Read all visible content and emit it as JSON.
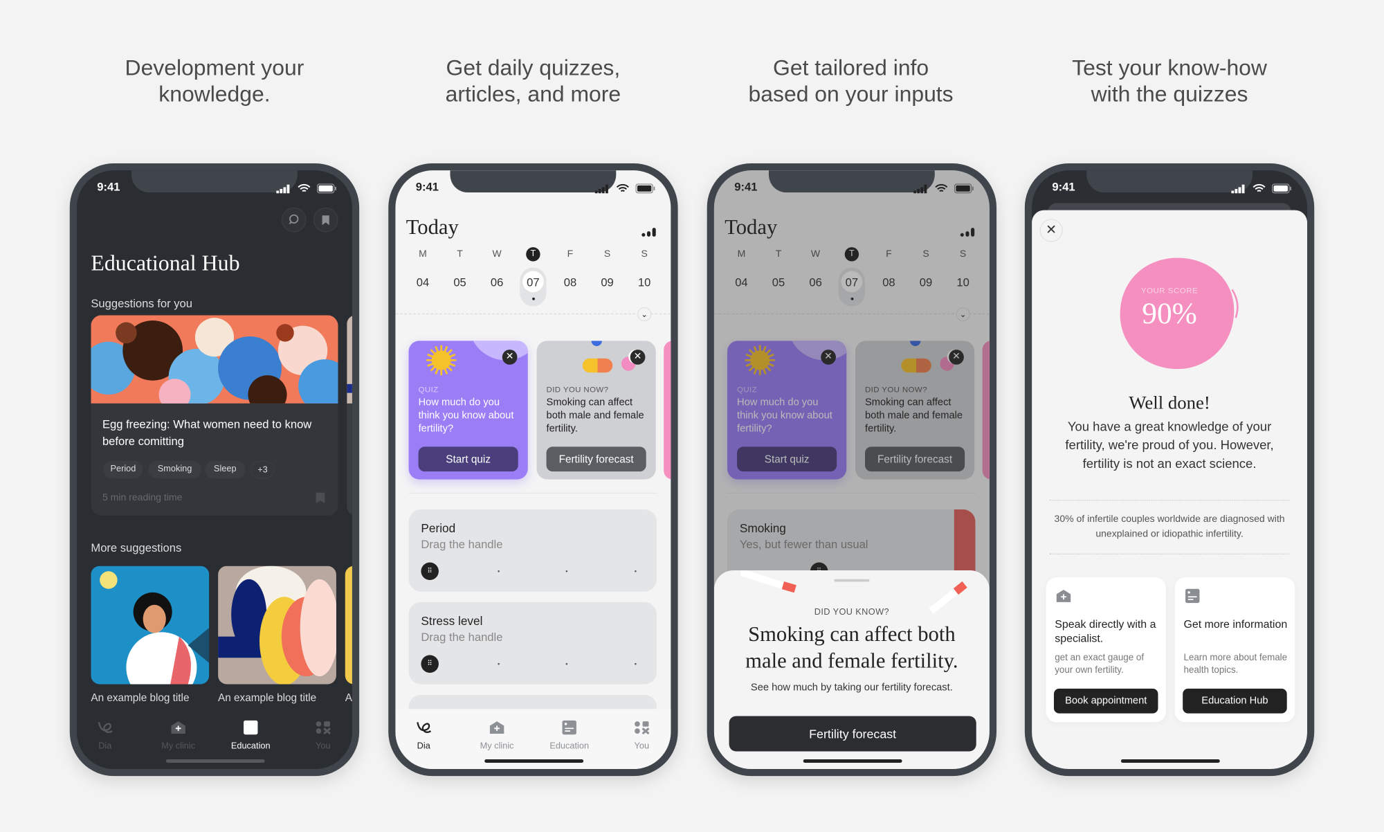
{
  "headings": [
    {
      "line1": "Development your",
      "line2": "knowledge."
    },
    {
      "line1": "Get daily quizzes,",
      "line2": "articles, and more"
    },
    {
      "line1": "Get tailored info",
      "line2": "based on your inputs"
    },
    {
      "line1": "Test your know-how",
      "line2": "with the quizzes"
    }
  ],
  "status": {
    "time": "9:41"
  },
  "tabs": [
    {
      "label": "Dia",
      "icon": "dia-logo-icon"
    },
    {
      "label": "My clinic",
      "icon": "clinic-icon"
    },
    {
      "label": "Education",
      "icon": "education-icon"
    },
    {
      "label": "You",
      "icon": "you-icon"
    }
  ],
  "hub": {
    "title": "Educational Hub",
    "suggestions_label": "Suggestions for you",
    "featured": {
      "title": "Egg freezing: What women need to know before comitting",
      "tags": [
        "Period",
        "Smoking",
        "Sleep",
        "+3"
      ],
      "reading_time": "5 min reading time"
    },
    "more_label": "More suggestions",
    "more": [
      {
        "title": "An example blog title"
      },
      {
        "title": "An example blog title"
      },
      {
        "title": "A"
      }
    ],
    "active_tab": "Education"
  },
  "today": {
    "title": "Today",
    "weekdays": [
      "M",
      "T",
      "W",
      "T",
      "F",
      "S",
      "S"
    ],
    "dates": [
      "04",
      "05",
      "06",
      "07",
      "08",
      "09",
      "10"
    ],
    "selected_index": 3,
    "quiz_card": {
      "kicker": "QUIZ",
      "text": "How much do you think you know about fertility?",
      "button": "Start quiz",
      "color": "#9b7ef6"
    },
    "info_card": {
      "kicker": "DID YOU NOW?",
      "text": "Smoking can affect both male and female fertility.",
      "button": "Fertility forecast"
    },
    "trackers": [
      {
        "title": "Period",
        "hint": "Drag the handle"
      },
      {
        "title": "Stress level",
        "hint": "Drag the handle"
      }
    ],
    "smoking_tracker": {
      "title": "Smoking",
      "hint": "Yes, but fewer than usual"
    },
    "active_tab": "Dia"
  },
  "sheet": {
    "kicker": "DID YOU KNOW?",
    "headline": "Smoking can affect both male and female fertility.",
    "subtext": "See how much by taking our fertility forecast.",
    "button": "Fertility forecast"
  },
  "result": {
    "score_label": "YOUR SCORE",
    "score": "90%",
    "score_color": "#f48fbf",
    "title": "Well done!",
    "body": "You have a great knowledge of your fertility, we're proud of you. However, fertility is not an exact science.",
    "fact": "30% of infertile couples worldwide are diagnosed with unexplained or idiopathic infertility.",
    "cards": [
      {
        "title": "Speak directly with a specialist.",
        "desc": "get an exact gauge of your own fertility.",
        "button": "Book appointment",
        "icon": "clinic-icon"
      },
      {
        "title": "Get more information",
        "desc": "Learn more about female health topics.",
        "button": "Education Hub",
        "icon": "education-icon"
      }
    ]
  }
}
